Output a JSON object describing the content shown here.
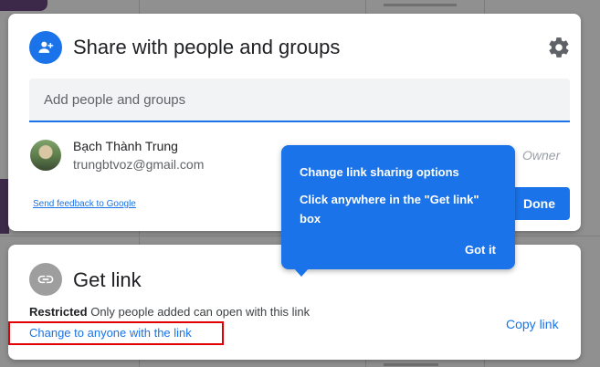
{
  "share": {
    "title": "Share with people and groups",
    "input_placeholder": "Add people and groups",
    "person": {
      "name": "Bạch Thành Trung",
      "email": "trungbtvoz@gmail.com",
      "role": "Owner"
    },
    "feedback_link": "Send feedback to Google",
    "done_label": "Done",
    "icons": {
      "header": "add-person-icon",
      "settings": "gear-icon"
    }
  },
  "get_link": {
    "title": "Get link",
    "restricted_label": "Restricted",
    "restricted_desc": "Only people added can open with this link",
    "change_label": "Change to anyone with the link",
    "copy_label": "Copy link",
    "icons": {
      "header": "link-icon"
    }
  },
  "tooltip": {
    "title": "Change link sharing options",
    "body": "Click anywhere in the \"Get link\" box",
    "action": "Got it"
  },
  "colors": {
    "accent": "#1a73e8",
    "highlight_box": "#e10000",
    "link_icon_bg": "#9e9e9e"
  }
}
